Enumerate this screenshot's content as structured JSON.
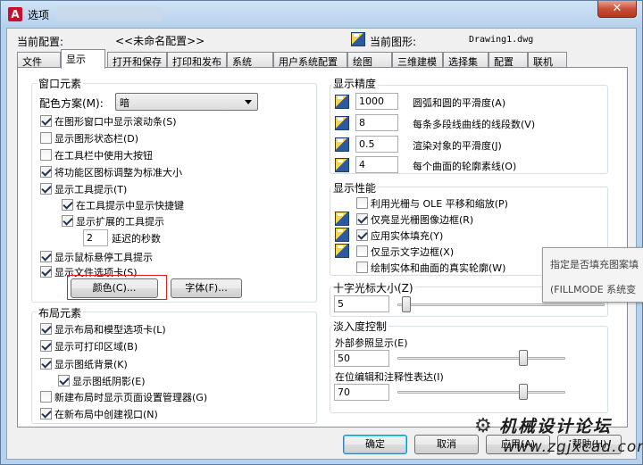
{
  "window": {
    "title": "选项",
    "close_glyph": "✕"
  },
  "header": {
    "current_profile_label": "当前配置:",
    "current_profile_value": "<<未命名配置>>",
    "current_drawing_label": "当前图形:",
    "current_drawing_value": "Drawing1.dwg"
  },
  "tabs": [
    {
      "label": "文件"
    },
    {
      "label": "显示",
      "active": true
    },
    {
      "label": "打开和保存"
    },
    {
      "label": "打印和发布"
    },
    {
      "label": "系统"
    },
    {
      "label": "用户系统配置"
    },
    {
      "label": "绘图"
    },
    {
      "label": "三维建模"
    },
    {
      "label": "选择集"
    },
    {
      "label": "配置"
    },
    {
      "label": "联机"
    }
  ],
  "window_elements": {
    "title": "窗口元素",
    "color_scheme_label": "配色方案(M):",
    "color_scheme_value": "暗",
    "items": [
      {
        "label": "在图形窗口中显示滚动条(S)",
        "checked": true
      },
      {
        "label": "显示图形状态栏(D)",
        "checked": false
      },
      {
        "label": "在工具栏中使用大按钮",
        "checked": false
      },
      {
        "label": "将功能区图标调整为标准大小",
        "checked": true
      },
      {
        "label": "显示工具提示(T)",
        "checked": true
      },
      {
        "label": "在工具提示中显示快捷键",
        "checked": true
      },
      {
        "label": "显示扩展的工具提示",
        "checked": true
      },
      {
        "label": "显示鼠标悬停工具提示",
        "checked": true
      },
      {
        "label": "显示文件选项卡(S)",
        "checked": true
      }
    ],
    "delay_value": "2",
    "delay_label": "延迟的秒数",
    "colors_button": "颜色(C)...",
    "fonts_button": "字体(F)..."
  },
  "layout_elements": {
    "title": "布局元素",
    "items": [
      {
        "label": "显示布局和模型选项卡(L)",
        "checked": true
      },
      {
        "label": "显示可打印区域(B)",
        "checked": true
      },
      {
        "label": "显示图纸背景(K)",
        "checked": true
      },
      {
        "label": "显示图纸阴影(E)",
        "checked": true
      },
      {
        "label": "新建布局时显示页面设置管理器(G)",
        "checked": false
      },
      {
        "label": "在新布局中创建视口(N)",
        "checked": true
      }
    ]
  },
  "display_resolution": {
    "title": "显示精度",
    "items": [
      {
        "value": "1000",
        "label": "圆弧和圆的平滑度(A)"
      },
      {
        "value": "8",
        "label": "每条多段线曲线的线段数(V)"
      },
      {
        "value": "0.5",
        "label": "渲染对象的平滑度(J)"
      },
      {
        "value": "4",
        "label": "每个曲面的轮廓素线(O)"
      }
    ]
  },
  "display_performance": {
    "title": "显示性能",
    "items": [
      {
        "label": "利用光栅与 OLE 平移和缩放(P)",
        "checked": false,
        "icon": false
      },
      {
        "label": "仅亮显光栅图像边框(R)",
        "checked": true,
        "icon": true
      },
      {
        "label": "应用实体填充(Y)",
        "checked": true,
        "icon": true
      },
      {
        "label": "仅显示文字边框(X)",
        "checked": false,
        "icon": true
      },
      {
        "label": "绘制实体和曲面的真实轮廓(W)",
        "checked": false,
        "icon": false
      }
    ]
  },
  "crosshair": {
    "title": "十字光标大小(Z)",
    "value": "5",
    "level_percent": 5
  },
  "fade_control": {
    "title": "淡入度控制",
    "xref_label": "外部参照显示(E)",
    "xref_value": "50",
    "inplace_label": "在位编辑和注释性表达(I)",
    "inplace_value": "70"
  },
  "tooltip": {
    "line1": "指定是否填充图案填",
    "line2": "(FILLMODE 系统变"
  },
  "footer": {
    "ok": "确定",
    "cancel": "取消",
    "apply": "应用(A)",
    "help": "帮助(H)"
  },
  "watermark": {
    "text": "机械设计论坛",
    "url": "www.zgjxcad.com"
  },
  "colors": {
    "accent": "#3c7fb1",
    "highlight_border": "#e02020"
  }
}
